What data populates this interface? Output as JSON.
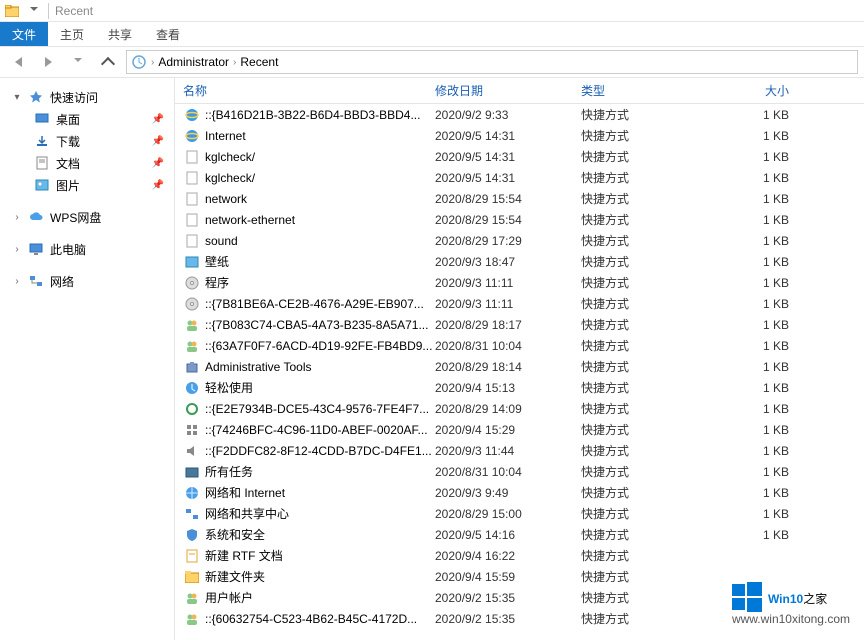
{
  "titlebar": {
    "title": "Recent"
  },
  "ribbon": {
    "file": "文件",
    "home": "主页",
    "share": "共享",
    "view": "查看"
  },
  "breadcrumbs": {
    "items": [
      "Administrator",
      "Recent"
    ]
  },
  "sidebar": {
    "quick": "快速访问",
    "desktop": "桌面",
    "downloads": "下载",
    "documents": "文档",
    "pictures": "图片",
    "wps": "WPS网盘",
    "thispc": "此电脑",
    "network": "网络"
  },
  "columns": {
    "name": "名称",
    "date": "修改日期",
    "type": "类型",
    "size": "大小"
  },
  "files": [
    {
      "icon": "ie",
      "name": "::{B416D21B-3B22-B6D4-BBD3-BBD4...",
      "date": "2020/9/2 9:33",
      "type": "快捷方式",
      "size": "1 KB"
    },
    {
      "icon": "ie",
      "name": "Internet",
      "date": "2020/9/5 14:31",
      "type": "快捷方式",
      "size": "1 KB"
    },
    {
      "icon": "file",
      "name": "kglcheck/",
      "date": "2020/9/5 14:31",
      "type": "快捷方式",
      "size": "1 KB"
    },
    {
      "icon": "file",
      "name": "kglcheck/",
      "date": "2020/9/5 14:31",
      "type": "快捷方式",
      "size": "1 KB"
    },
    {
      "icon": "file",
      "name": "network",
      "date": "2020/8/29 15:54",
      "type": "快捷方式",
      "size": "1 KB"
    },
    {
      "icon": "file",
      "name": "network-ethernet",
      "date": "2020/8/29 15:54",
      "type": "快捷方式",
      "size": "1 KB"
    },
    {
      "icon": "file",
      "name": "sound",
      "date": "2020/8/29 17:29",
      "type": "快捷方式",
      "size": "1 KB"
    },
    {
      "icon": "img",
      "name": "壁纸",
      "date": "2020/9/3 18:47",
      "type": "快捷方式",
      "size": "1 KB"
    },
    {
      "icon": "cd",
      "name": "程序",
      "date": "2020/9/3 11:11",
      "type": "快捷方式",
      "size": "1 KB"
    },
    {
      "icon": "cd",
      "name": "::{7B81BE6A-CE2B-4676-A29E-EB907...",
      "date": "2020/9/3 11:11",
      "type": "快捷方式",
      "size": "1 KB"
    },
    {
      "icon": "users",
      "name": "::{7B083C74-CBA5-4A73-B235-8A5A71...",
      "date": "2020/8/29 18:17",
      "type": "快捷方式",
      "size": "1 KB"
    },
    {
      "icon": "users",
      "name": "::{63A7F0F7-6ACD-4D19-92FE-FB4BD9...",
      "date": "2020/8/31 10:04",
      "type": "快捷方式",
      "size": "1 KB"
    },
    {
      "icon": "tools",
      "name": "Administrative Tools",
      "date": "2020/8/29 18:14",
      "type": "快捷方式",
      "size": "1 KB"
    },
    {
      "icon": "ease",
      "name": "轻松使用",
      "date": "2020/9/4 15:13",
      "type": "快捷方式",
      "size": "1 KB"
    },
    {
      "icon": "sync",
      "name": "::{E2E7934B-DCE5-43C4-9576-7FE4F7...",
      "date": "2020/8/29 14:09",
      "type": "快捷方式",
      "size": "1 KB"
    },
    {
      "icon": "ctrl",
      "name": "::{74246BFC-4C96-11D0-ABEF-0020AF...",
      "date": "2020/9/4 15:29",
      "type": "快捷方式",
      "size": "1 KB"
    },
    {
      "icon": "snd",
      "name": "::{F2DDFC82-8F12-4CDD-B7DC-D4FE1...",
      "date": "2020/9/3 11:44",
      "type": "快捷方式",
      "size": "1 KB"
    },
    {
      "icon": "task",
      "name": "所有任务",
      "date": "2020/8/31 10:04",
      "type": "快捷方式",
      "size": "1 KB"
    },
    {
      "icon": "net",
      "name": "网络和 Internet",
      "date": "2020/9/3 9:49",
      "type": "快捷方式",
      "size": "1 KB"
    },
    {
      "icon": "netc",
      "name": "网络和共享中心",
      "date": "2020/8/29 15:00",
      "type": "快捷方式",
      "size": "1 KB"
    },
    {
      "icon": "sec",
      "name": "系统和安全",
      "date": "2020/9/5 14:16",
      "type": "快捷方式",
      "size": "1 KB"
    },
    {
      "icon": "rtf",
      "name": "新建 RTF 文档",
      "date": "2020/9/4 16:22",
      "type": "快捷方式",
      "size": ""
    },
    {
      "icon": "folder",
      "name": "新建文件夹",
      "date": "2020/9/4 15:59",
      "type": "快捷方式",
      "size": ""
    },
    {
      "icon": "users",
      "name": "用户帐户",
      "date": "2020/9/2 15:35",
      "type": "快捷方式",
      "size": ""
    },
    {
      "icon": "users",
      "name": "::{60632754-C523-4B62-B45C-4172D...",
      "date": "2020/9/2 15:35",
      "type": "快捷方式",
      "size": ""
    }
  ],
  "watermark": {
    "brand_a": "Win",
    "brand_b": "10",
    "brand_c": "之家",
    "url": "www.win10xitong.com"
  }
}
